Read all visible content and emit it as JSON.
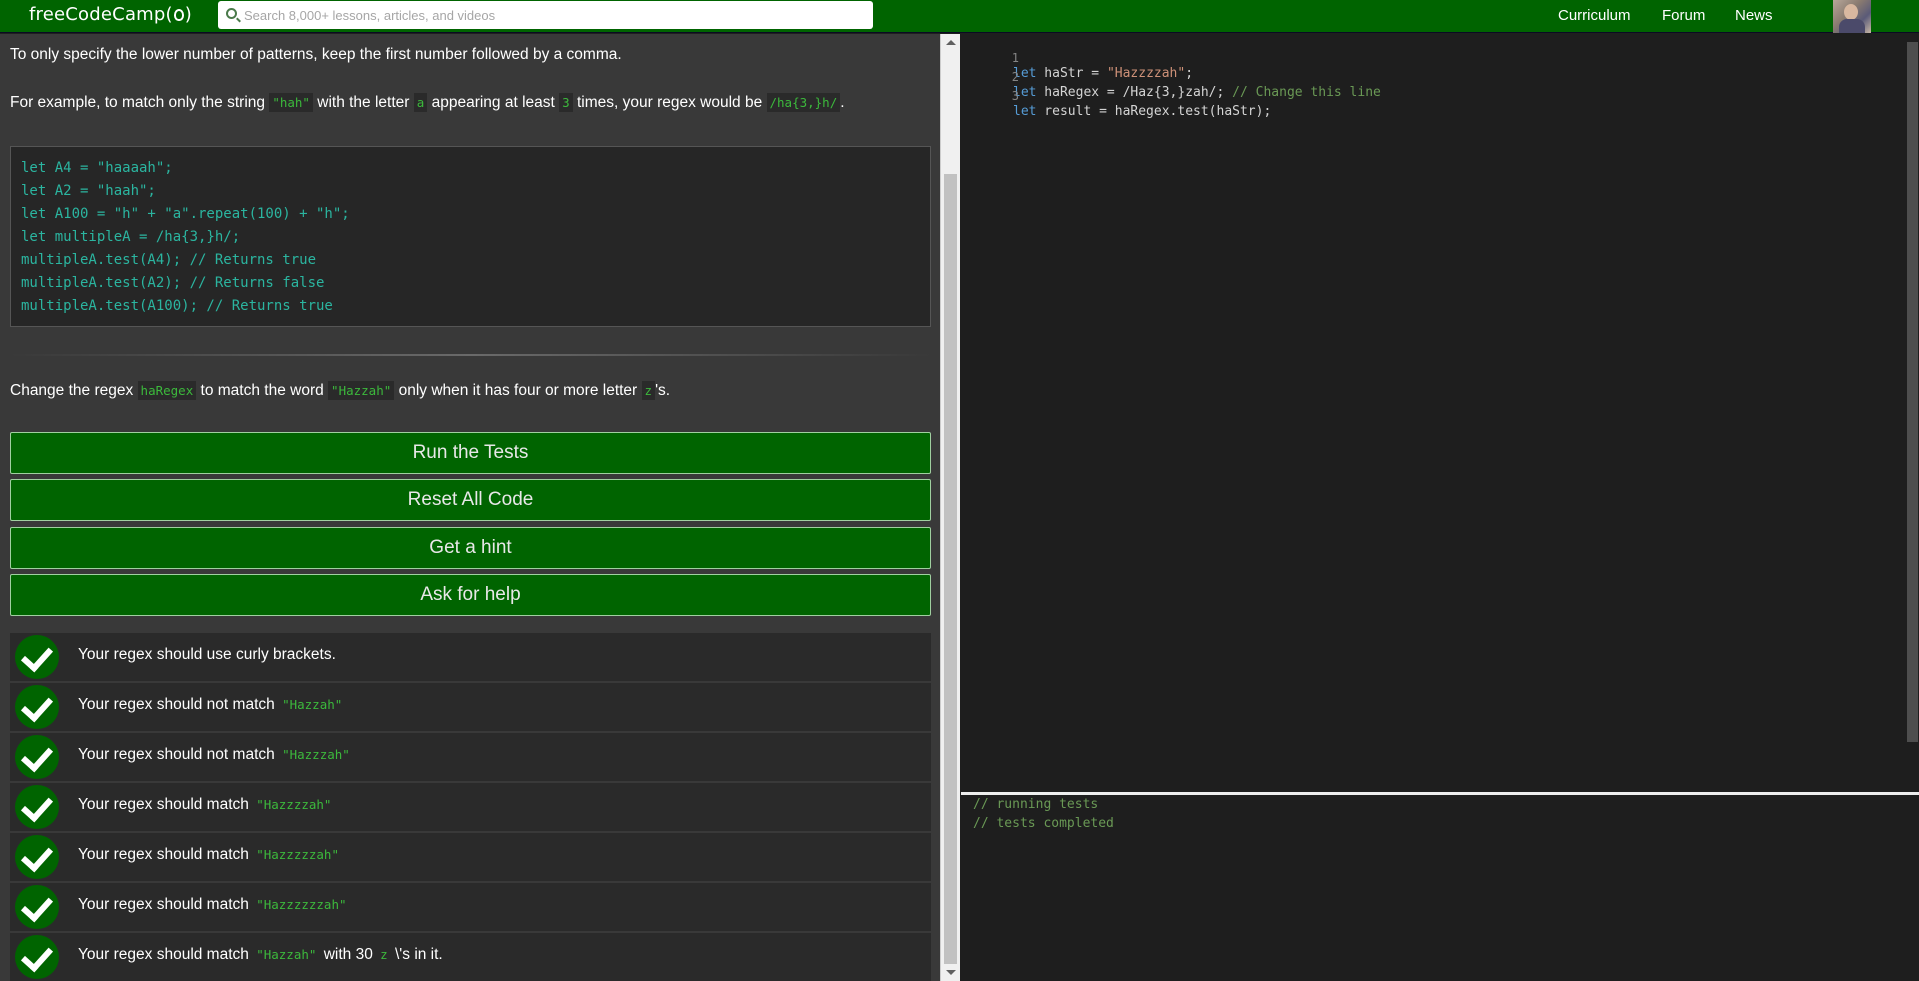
{
  "nav": {
    "logo": "freeCodeCamp",
    "search_placeholder": "Search 8,000+ lessons, articles, and videos",
    "links": [
      "Curriculum",
      "Forum",
      "News"
    ]
  },
  "lesson": {
    "para1": "To only specify the lower number of patterns, keep the first number followed by a comma.",
    "para2": {
      "a": "For example, to match only the string ",
      "code1": "\"hah\"",
      "b": " with the letter ",
      "code2": "a",
      "c": " appearing at least ",
      "code3": "3",
      "d": " times, your regex would be ",
      "code4": "/ha{3,}h/",
      "e": "."
    },
    "code_lines": [
      "let A4 = \"haaaah\";",
      "let A2 = \"haah\";",
      "let A100 = \"h\" + \"a\".repeat(100) + \"h\";",
      "let multipleA = /ha{3,}h/;",
      "multipleA.test(A4); // Returns true",
      "multipleA.test(A2); // Returns false",
      "multipleA.test(A100); // Returns true"
    ],
    "task": {
      "a": "Change the regex ",
      "code1": "haRegex",
      "b": " to match the word ",
      "code2": "\"Hazzah\"",
      "c": " only when it has four or more letter ",
      "code3": "z",
      "d": "'s."
    }
  },
  "buttons": {
    "run": "Run the Tests",
    "reset": "Reset All Code",
    "hint": "Get a hint",
    "help": "Ask for help"
  },
  "tests": [
    {
      "text": "Your regex should use curly brackets.",
      "code": "",
      "tail": "",
      "code2": "",
      "tail2": ""
    },
    {
      "text": "Your regex should not match ",
      "code": "\"Hazzah\"",
      "tail": "",
      "code2": "",
      "tail2": ""
    },
    {
      "text": "Your regex should not match ",
      "code": "\"Hazzzah\"",
      "tail": "",
      "code2": "",
      "tail2": ""
    },
    {
      "text": "Your regex should match ",
      "code": "\"Hazzzzah\"",
      "tail": "",
      "code2": "",
      "tail2": ""
    },
    {
      "text": "Your regex should match ",
      "code": "\"Hazzzzzah\"",
      "tail": "",
      "code2": "",
      "tail2": ""
    },
    {
      "text": "Your regex should match ",
      "code": "\"Hazzzzzzah\"",
      "tail": "",
      "code2": "",
      "tail2": ""
    },
    {
      "text": "Your regex should match ",
      "code": "\"Hazzah\"",
      "tail": " with 30 ",
      "code2": "z",
      "tail2": " \\'s in it."
    }
  ],
  "editor": {
    "lines": [
      {
        "num": "1",
        "kw": "let",
        "rest": " haStr = ",
        "str": "\"Hazzzzah\"",
        "after": ";",
        "cmt": ""
      },
      {
        "num": "2",
        "kw": "let",
        "rest": " haRegex = /Haz{3,}zah/; ",
        "str": "",
        "after": "",
        "cmt": "// Change this line"
      },
      {
        "num": "3",
        "kw": "let",
        "rest": " result = haRegex.test(haStr);",
        "str": "",
        "after": "",
        "cmt": ""
      }
    ]
  },
  "console": {
    "lines": [
      "// running tests",
      "// tests completed"
    ]
  }
}
